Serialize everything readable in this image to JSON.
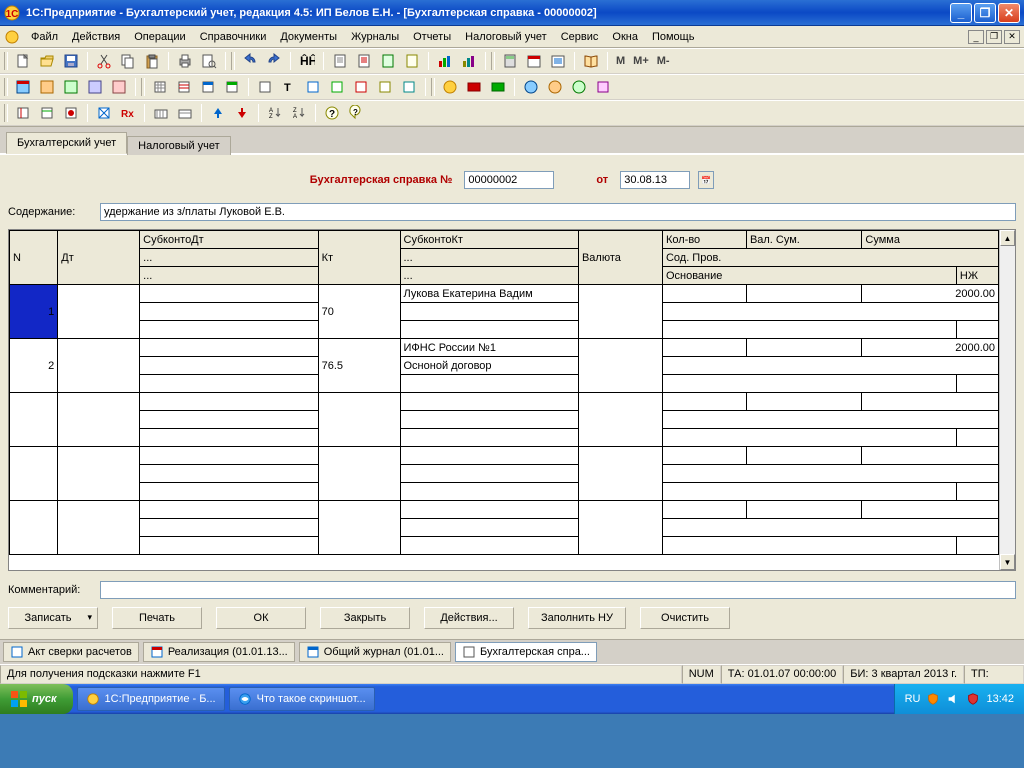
{
  "titlebar": {
    "title": "1С:Предприятие - Бухгалтерский учет, редакция 4.5: ИП Белов Е.Н. - [Бухгалтерская справка - 00000002]"
  },
  "menu": {
    "file": "Файл",
    "actions": "Действия",
    "operations": "Операции",
    "directories": "Справочники",
    "documents": "Документы",
    "journals": "Журналы",
    "reports": "Отчеты",
    "tax": "Налоговый учет",
    "service": "Сервис",
    "windows": "Окна",
    "help": "Помощь"
  },
  "tabs": {
    "accounting": "Бухгалтерский учет",
    "tax": "Налоговый учет"
  },
  "doc": {
    "title_label": "Бухгалтерская справка №",
    "number": "00000002",
    "date_label": "от",
    "date": "30.08.13",
    "content_label": "Содержание:",
    "content": "удержание из з/платы Луковой Е.В.",
    "comment_label": "Комментарий:",
    "comment": ""
  },
  "grid": {
    "headers": {
      "n": "N",
      "dt": "Дт",
      "subkontodt": "СубконтоДт",
      "kt": "Кт",
      "subkontokt": "СубконтоКт",
      "currency": "Валюта",
      "qty": "Кол-во",
      "valsum": "Вал. Сум.",
      "sum": "Сумма",
      "sodprov": "Сод. Пров.",
      "basis": "Основание",
      "nzh": "НЖ"
    },
    "filter_placeholder": "...",
    "rows": [
      {
        "n": "1",
        "dt": "",
        "sdt1": "",
        "sdt2": "",
        "sdt3": "",
        "kt": "70",
        "skt1": "Лукова Екатерина Вадим",
        "skt2": "",
        "skt3": "",
        "cur": "",
        "qty": "",
        "vs": "",
        "sum": "2000.00"
      },
      {
        "n": "2",
        "dt": "",
        "sdt1": "",
        "sdt2": "",
        "sdt3": "",
        "kt": "76.5",
        "skt1": "ИФНС России №1",
        "skt2": "Осноной договор",
        "skt3": "",
        "cur": "",
        "qty": "",
        "vs": "",
        "sum": "2000.00"
      }
    ]
  },
  "buttons": {
    "save": "Записать",
    "print": "Печать",
    "ok": "ОК",
    "close": "Закрыть",
    "actions": "Действия...",
    "fill_nu": "Заполнить НУ",
    "clear": "Очистить"
  },
  "mdi_tabs": {
    "t1": "Акт сверки расчетов",
    "t2": "Реализация (01.01.13...",
    "t3": "Общий журнал (01.01...",
    "t4": "Бухгалтерская спра..."
  },
  "statusbar": {
    "hint": "Для получения подсказки нажмите F1",
    "num": "NUM",
    "ta": "ТА: 01.01.07  00:00:00",
    "bi": "БИ: 3 квартал 2013 г.",
    "tp": "ТП:"
  },
  "taskbar": {
    "start": "пуск",
    "task1": "1С:Предприятие - Б...",
    "task2": "Что такое скриншот...",
    "lang": "RU",
    "time": "13:42"
  },
  "toolbar_text": {
    "m": "M",
    "mplus": "M+",
    "mminus": "M-"
  }
}
